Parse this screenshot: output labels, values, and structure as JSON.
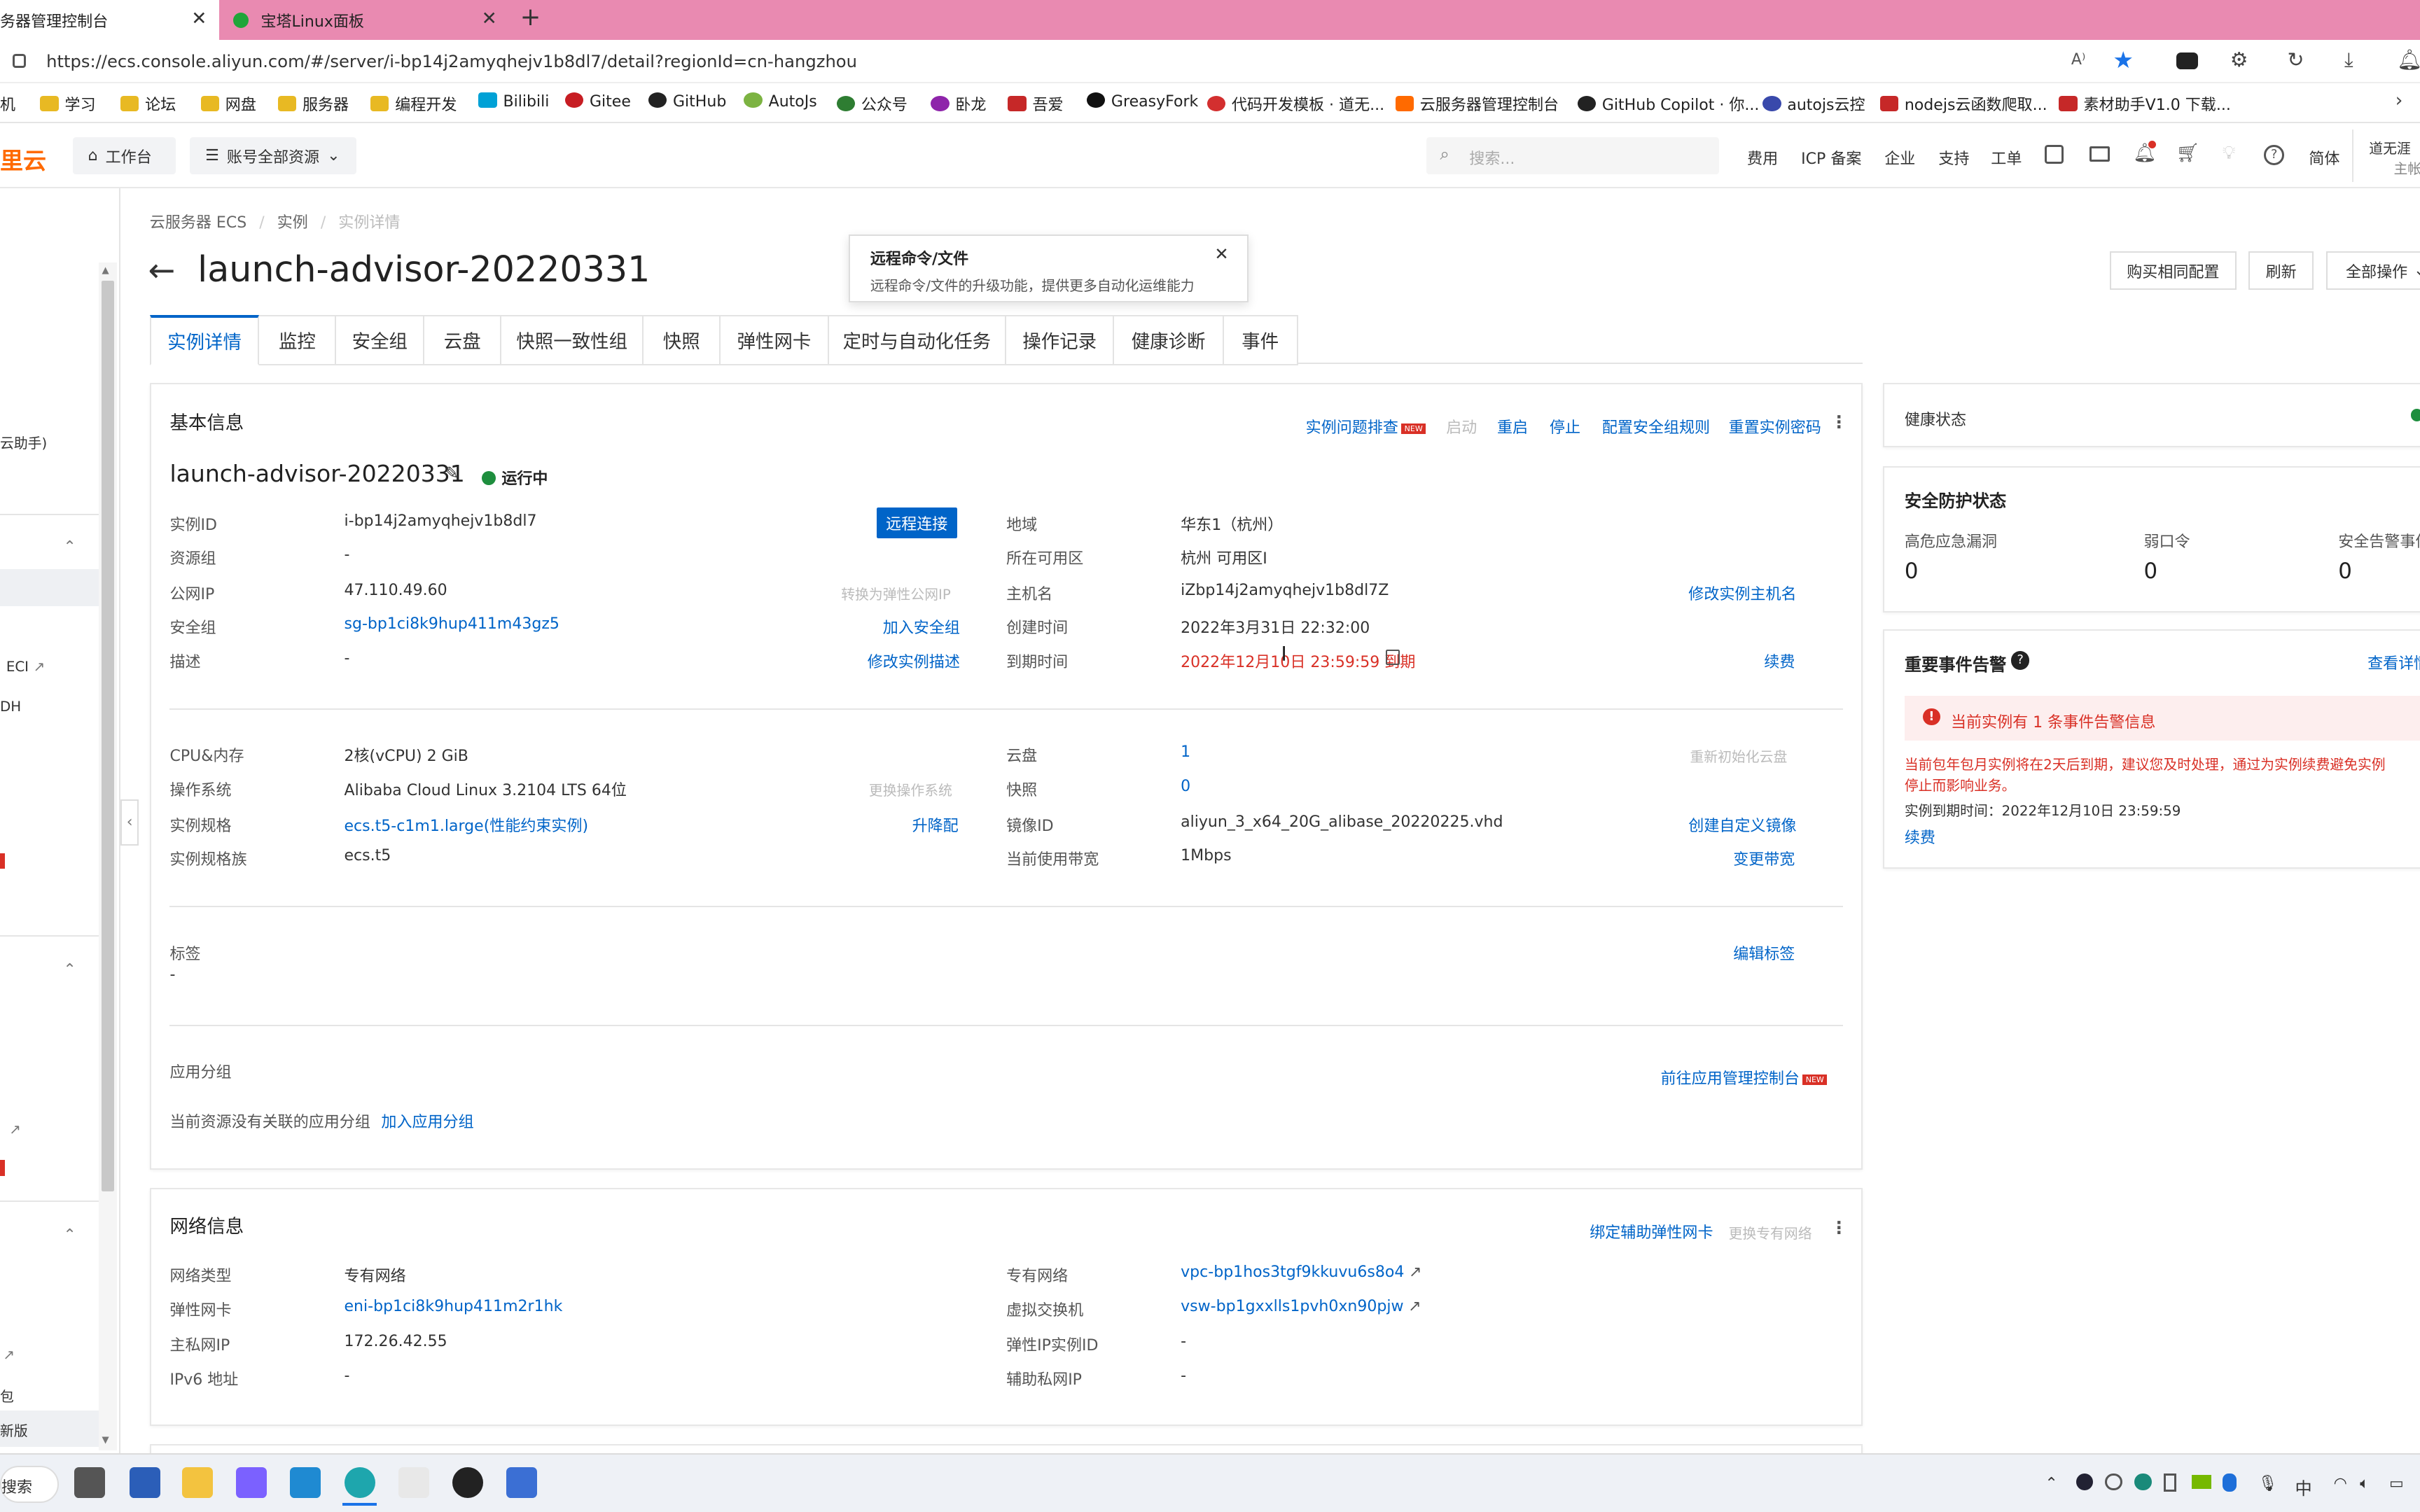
{
  "browser": {
    "tabs": [
      {
        "label": "务器管理控制台",
        "active": true
      },
      {
        "label": "宝塔Linux面板",
        "active": false
      }
    ],
    "url": "https://ecs.console.aliyun.com/#/server/i-bp14j2amyqhejv1b8dl7/detail?regionId=cn-hangzhou",
    "bookmarks": [
      "机",
      "学习",
      "论坛",
      "网盘",
      "服务器",
      "编程开发",
      "Bilibili",
      "Gitee",
      "GitHub",
      "AutoJs",
      "公众号",
      "卧龙",
      "吾爱",
      "GreasyFork",
      "代码开发模板 · 道无...",
      "云服务器管理控制台",
      "GitHub Copilot · 你...",
      "autojs云控",
      "nodejs云函数爬取...",
      "素材助手V1.0 下载..."
    ]
  },
  "console": {
    "logo": "里云",
    "workbench": "工作台",
    "account_scope": "账号全部资源",
    "search_placeholder": "搜索...",
    "nav": [
      "费用",
      "ICP 备案",
      "企业",
      "支持",
      "工单"
    ],
    "lang": "简体",
    "user_line1": "道无涯",
    "user_line2": "主帐"
  },
  "sidebar": {
    "items": [
      "云助手)",
      "ECI",
      "DH",
      "包",
      "新版"
    ]
  },
  "breadcrumb": [
    "云服务器 ECS",
    "实例",
    "实例详情"
  ],
  "page_title": "launch-advisor-20220331",
  "actions": {
    "buy_same": "购买相同配置",
    "refresh": "刷新",
    "all_ops": "全部操作"
  },
  "popover": {
    "title": "远程命令/文件",
    "body": "远程命令/文件的升级功能，提供更多自动化运维能力"
  },
  "tabs": [
    "实例详情",
    "监控",
    "安全组",
    "云盘",
    "快照一致性组",
    "快照",
    "弹性网卡",
    "定时与自动化任务",
    "操作记录",
    "健康诊断",
    "事件"
  ],
  "basic": {
    "title": "基本信息",
    "toolbar": {
      "troubleshoot": "实例问题排查",
      "new": "NEW",
      "start": "启动",
      "restart": "重启",
      "stop": "停止",
      "sg_rule": "配置安全组规则",
      "reset_pwd": "重置实例密码"
    },
    "instance_name": "launch-advisor-20220331",
    "status": "运行中",
    "remote_connect": "远程连接",
    "left_rows": [
      {
        "label": "实例ID",
        "value": "i-bp14j2amyqhejv1b8dl7",
        "action": ""
      },
      {
        "label": "资源组",
        "value": "-",
        "action": ""
      },
      {
        "label": "公网IP",
        "value": "47.110.49.60",
        "action": "转换为弹性公网IP"
      },
      {
        "label": "安全组",
        "value": "sg-bp1ci8k9hup411m43gz5",
        "action": "加入安全组"
      },
      {
        "label": "描述",
        "value": "-",
        "action": "修改实例描述"
      }
    ],
    "right_rows": [
      {
        "label": "地域",
        "value": "华东1（杭州）",
        "action": ""
      },
      {
        "label": "所在可用区",
        "value": "杭州 可用区I",
        "action": ""
      },
      {
        "label": "主机名",
        "value": "iZbp14j2amyqhejv1b8dl7Z",
        "action": "修改实例主机名"
      },
      {
        "label": "创建时间",
        "value": "2022年3月31日 22:32:00",
        "action": ""
      },
      {
        "label": "到期时间",
        "value": "2022年12月10日 23:59:59 到期",
        "action": "续费"
      }
    ],
    "spec_left": [
      {
        "label": "CPU&内存",
        "value": "2核(vCPU) 2 GiB",
        "action": ""
      },
      {
        "label": "操作系统",
        "value": "Alibaba Cloud Linux 3.2104 LTS 64位",
        "action": "更换操作系统"
      },
      {
        "label": "实例规格",
        "value": "ecs.t5-c1m1.large(性能约束实例)",
        "action": "升降配"
      },
      {
        "label": "实例规格族",
        "value": "ecs.t5",
        "action": ""
      }
    ],
    "spec_right": [
      {
        "label": "云盘",
        "value": "1",
        "action": "重新初始化云盘"
      },
      {
        "label": "快照",
        "value": "0",
        "action": ""
      },
      {
        "label": "镜像ID",
        "value": "aliyun_3_x64_20G_alibase_20220225.vhd",
        "action": "创建自定义镜像"
      },
      {
        "label": "当前使用带宽",
        "value": "1Mbps",
        "action": "变更带宽"
      }
    ],
    "tags_label": "标签",
    "tags_value": "-",
    "edit_tags": "编辑标签",
    "app_group_label": "应用分组",
    "app_group_link": "前往应用管理控制台",
    "app_group_empty": "当前资源没有关联的应用分组",
    "join_app_group": "加入应用分组"
  },
  "network": {
    "title": "网络信息",
    "bind_eni": "绑定辅助弹性网卡",
    "change_vpc": "更换专有网络",
    "left_rows": [
      {
        "label": "网络类型",
        "value": "专有网络"
      },
      {
        "label": "弹性网卡",
        "value": "eni-bp1ci8k9hup411m2r1hk"
      },
      {
        "label": "主私网IP",
        "value": "172.26.42.55"
      },
      {
        "label": "IPv6 地址",
        "value": "-"
      }
    ],
    "right_rows": [
      {
        "label": "专有网络",
        "value": "vpc-bp1hos3tgf9kkuvu6s8o4"
      },
      {
        "label": "虚拟交换机",
        "value": "vsw-bp1gxxlls1pvh0xn90pjw"
      },
      {
        "label": "弹性IP实例ID",
        "value": "-"
      },
      {
        "label": "辅助私网IP",
        "value": "-"
      }
    ]
  },
  "health": {
    "title": "健康状态"
  },
  "security": {
    "title": "安全防护状态",
    "items": [
      {
        "label": "高危应急漏洞",
        "value": "0"
      },
      {
        "label": "弱口令",
        "value": "0"
      },
      {
        "label": "安全告警事件",
        "value": "0"
      }
    ]
  },
  "events": {
    "title": "重要事件告警",
    "view_detail": "查看详情",
    "alert_title": "当前实例有 1 条事件告警信息",
    "alert_body1": "当前包年包月实例将在2天后到期，建议您及时处理，通过为实例续费避免实例",
    "alert_body2": "停止而影响业务。",
    "expire_line": "实例到期时间：2022年12月10日 23:59:59",
    "renew": "续费"
  },
  "taskbar": {
    "search": "搜索",
    "ime": "中"
  },
  "colors": {
    "link": "#0064c8",
    "danger": "#d93026",
    "brand": "#ff6a00",
    "tabbar": "#e98ab1",
    "running": "#1e8e3e"
  }
}
